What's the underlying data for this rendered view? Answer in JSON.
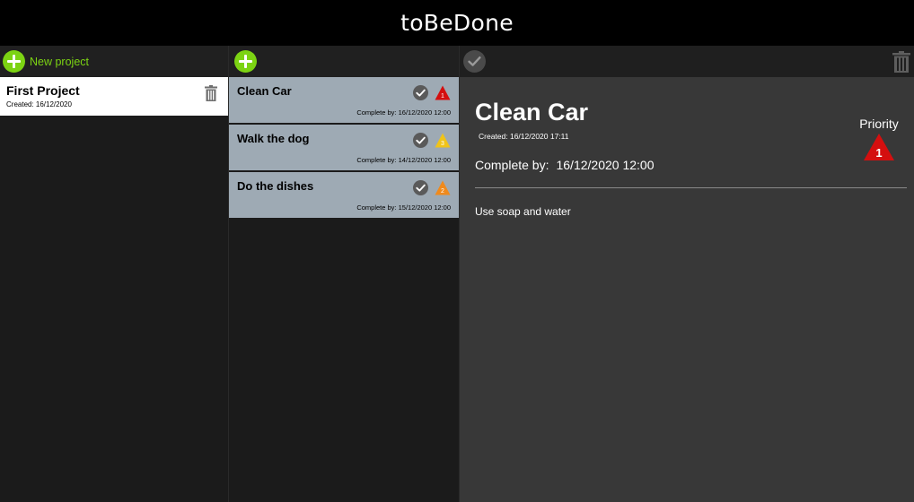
{
  "app": {
    "title": "toBeDone"
  },
  "projects": {
    "new_label": "New project",
    "items": [
      {
        "name": "First Project",
        "created": "Created: 16/12/2020"
      }
    ]
  },
  "tasks": {
    "items": [
      {
        "name": "Clean Car",
        "due": "Complete by: 16/12/2020 12:00",
        "priority": "1",
        "priority_color": "#d40f0f"
      },
      {
        "name": "Walk the dog",
        "due": "Complete by: 14/12/2020 12:00",
        "priority": "3",
        "priority_color": "#f0c419"
      },
      {
        "name": "Do the dishes",
        "due": "Complete by: 15/12/2020 12:00",
        "priority": "2",
        "priority_color": "#f08a1c"
      }
    ]
  },
  "detail": {
    "title": "Clean Car",
    "created": "Created: 16/12/2020 17:11",
    "due_label": "Complete by:",
    "due_value": "16/12/2020 12:00",
    "description": "Use soap and water",
    "priority_label": "Priority",
    "priority_value": "1",
    "priority_color": "#d40f0f"
  },
  "colors": {
    "accent": "#7cd313",
    "task_bg": "#9eaab4",
    "detail_bg": "#383838",
    "header_bg": "#000000"
  }
}
